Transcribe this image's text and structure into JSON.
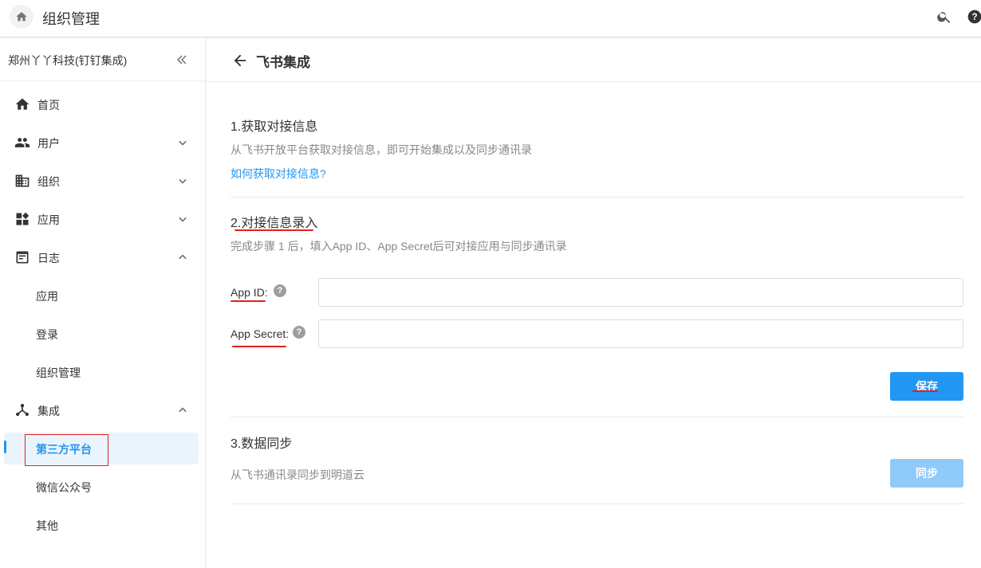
{
  "topbar": {
    "title": "组织管理",
    "icons": {
      "home": "home-icon",
      "search": "search-icon",
      "help": "help-icon"
    }
  },
  "sidebar": {
    "org_name": "郑州丫丫科技(钉钉集成)",
    "items": [
      {
        "label": "首页",
        "icon": "home-icon"
      },
      {
        "label": "用户",
        "icon": "users-icon",
        "expanded": false
      },
      {
        "label": "组织",
        "icon": "building-icon",
        "expanded": false
      },
      {
        "label": "应用",
        "icon": "apps-icon",
        "expanded": false
      },
      {
        "label": "日志",
        "icon": "log-icon",
        "expanded": true,
        "children": [
          "应用",
          "登录",
          "组织管理"
        ]
      },
      {
        "label": "集成",
        "icon": "integration-icon",
        "expanded": true,
        "children": [
          "第三方平台",
          "微信公众号",
          "其他"
        ]
      }
    ],
    "active_item": "第三方平台"
  },
  "page": {
    "title": "飞书集成",
    "section1": {
      "title": "1.获取对接信息",
      "desc": "从飞书开放平台获取对接信息，即可开始集成以及同步通讯录",
      "link": "如何获取对接信息?"
    },
    "section2": {
      "title": "2.对接信息录入",
      "desc": "完成步骤 1 后，填入App ID、App Secret后可对接应用与同步通讯录",
      "app_id_label": "App ID",
      "app_id_value": "",
      "app_secret_label": "App Secret",
      "app_secret_value": "",
      "colon": ":",
      "help_glyph": "?",
      "save_label": "保存"
    },
    "section3": {
      "title": "3.数据同步",
      "desc": "从飞书通讯录同步到明道云",
      "sync_label": "同步"
    }
  },
  "colors": {
    "accent": "#2196f3",
    "accent_disabled": "#90caf9",
    "annotation": "#e02020"
  }
}
